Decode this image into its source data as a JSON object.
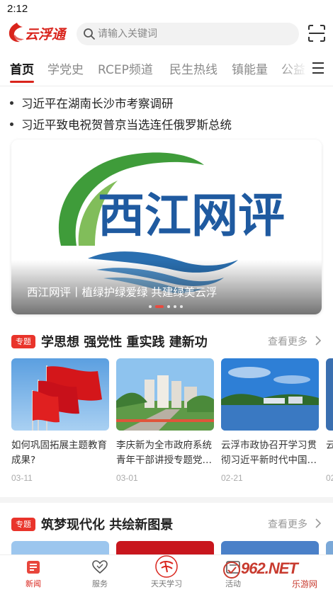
{
  "status_bar": {
    "time": "2:12"
  },
  "header": {
    "logo_text": "云浮通",
    "search_placeholder": "请输入关键词",
    "accent_color": "#d9241c"
  },
  "tabs": [
    {
      "label": "首页",
      "active": true
    },
    {
      "label": "学党史",
      "active": false
    },
    {
      "label": "RCEP频道",
      "active": false
    },
    {
      "label": "民生热线",
      "active": false
    },
    {
      "label": "镇能量",
      "active": false
    },
    {
      "label": "公益",
      "active": false
    }
  ],
  "headlines": [
    "习近平在湖南长沙市考察调研",
    "习近平致电祝贺普京当选连任俄罗斯总统"
  ],
  "carousel": {
    "logo_text": "西江网评",
    "caption": "西江网评丨植绿护绿爱绿 共建绿美云浮",
    "slide_count": 5,
    "active_slide": 1
  },
  "section1": {
    "badge": "专题",
    "title": "学思想 强党性 重实践 建新功",
    "more": "查看更多",
    "cards": [
      {
        "title": "如何巩固拓展主题教育成果?",
        "date": "03-11",
        "image": "red-flags"
      },
      {
        "title": "李庆新为全市政府系统青年干部讲授专题党…",
        "date": "03-01",
        "image": "city-buildings"
      },
      {
        "title": "云浮市政协召开学习贯彻习近平新时代中国…",
        "date": "02-21",
        "image": "lake-scenery"
      },
      {
        "title": "云",
        "date": "02",
        "image": "partial"
      }
    ]
  },
  "section2": {
    "badge": "专题",
    "title": "筑梦现代化 共绘新图景",
    "more": "查看更多"
  },
  "bottom_nav": [
    {
      "label": "新闻",
      "icon": "news-icon",
      "active": true
    },
    {
      "label": "服务",
      "icon": "heart-icon",
      "active": false
    },
    {
      "label": "天天学习",
      "icon": "study-icon",
      "active": false
    },
    {
      "label": "活动",
      "icon": "activity-icon",
      "active": false
    }
  ],
  "watermark": {
    "text": "962.NET",
    "sub": "乐游网"
  }
}
